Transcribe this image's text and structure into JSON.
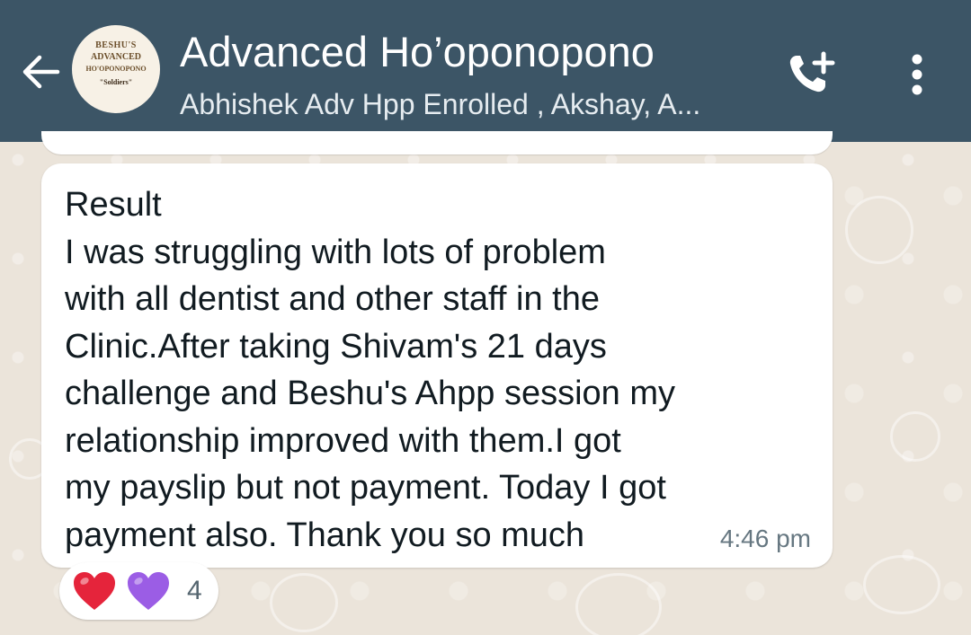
{
  "header": {
    "title": "Advanced Ho’oponopono",
    "subtitle": "Abhishek Adv Hpp Enrolled , Akshay, A...",
    "avatar": {
      "line1": "BESHU'S",
      "line2": "ADVANCED",
      "line3": "HO'OPONOPONO",
      "line4": "\"Soldiers\""
    },
    "background_color": "#3c5566",
    "icons": {
      "back": "arrow-left-icon",
      "call": "add-call-icon",
      "menu": "more-vertical-icon"
    }
  },
  "message": {
    "text": "Result\nI was struggling with lots of problem\nwith all dentist and other staff in the\nClinic.After taking Shivam's 21 days\nchallenge and Beshu's Ahpp session my\nrelationship improved with them.I got\nmy payslip but not payment. Today I got\npayment also. Thank you so much",
    "time": "4:46 pm"
  },
  "reactions": {
    "emojis": [
      "red-heart",
      "purple-heart"
    ],
    "count": "4",
    "colors": {
      "red_heart": "#e5243b",
      "purple_heart": "#9b5de5"
    }
  }
}
